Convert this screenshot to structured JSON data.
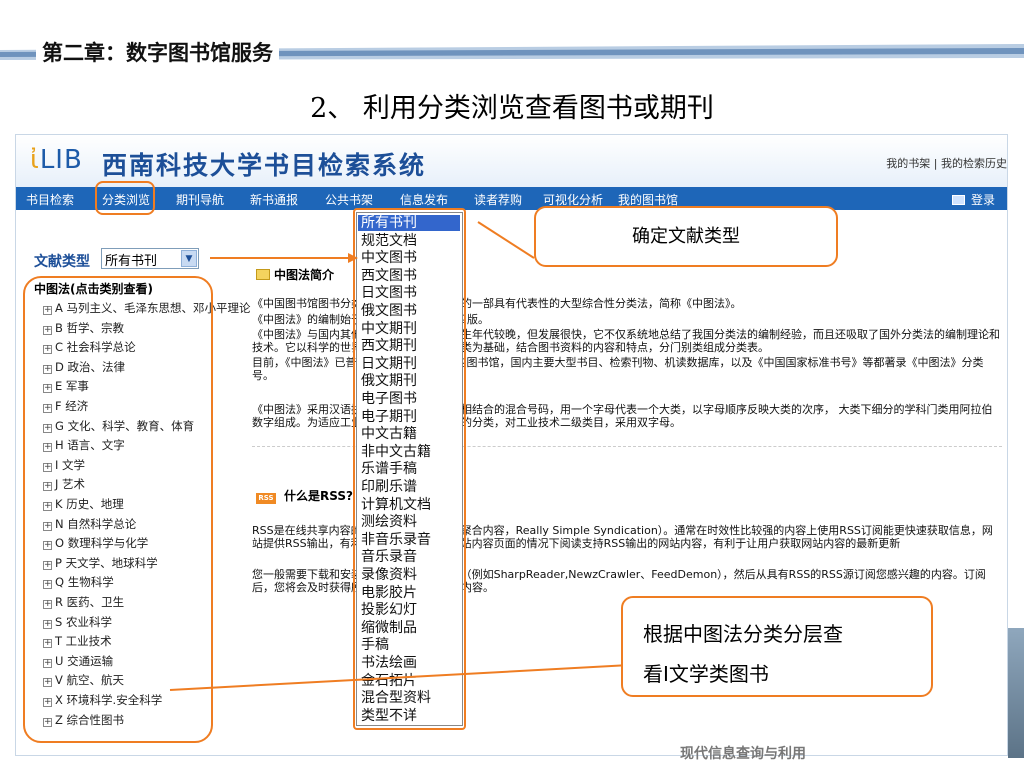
{
  "slide": {
    "chapter": "第二章：数字图书馆服务",
    "title": "2、 利用分类浏览查看图书或期刊",
    "watermark": "现代信息查询与利用"
  },
  "site": {
    "logo": "LIB",
    "title": "西南科技大学书目检索系统",
    "top_links": "我的书架 | 我的检索历史",
    "nav": [
      "书目检索",
      "分类浏览",
      "期刊导航",
      "新书通报",
      "公共书架",
      "信息发布",
      "读者荐购",
      "可视化分析",
      "我的图书馆"
    ],
    "login": "登录"
  },
  "filter": {
    "label": "文献类型",
    "selected": "所有书刊",
    "tree_heading": "中图法(点击类别查看)"
  },
  "categories": [
    "A 马列主义、毛泽东思想、邓小平理论",
    "B 哲学、宗教",
    "C 社会科学总论",
    "D 政治、法律",
    "E 军事",
    "F 经济",
    "G 文化、科学、教育、体育",
    "H 语言、文字",
    "I 文学",
    "J 艺术",
    "K 历史、地理",
    "N 自然科学总论",
    "O 数理科学与化学",
    "P 天文学、地球科学",
    "Q 生物科学",
    "R 医药、卫生",
    "S 农业科学",
    "T 工业技术",
    "U 交通运输",
    "V 航空、航天",
    "X 环境科学.安全科学",
    "Z 综合性图书"
  ],
  "doc_types": [
    "所有书刊",
    "规范文档",
    "中文图书",
    "西文图书",
    "日文图书",
    "俄文图书",
    "中文期刊",
    "西文期刊",
    "日文期刊",
    "俄文期刊",
    "电子图书",
    "电子期刊",
    "中文古籍",
    "非中文古籍",
    "乐谱手稿",
    "印刷乐谱",
    "计算机文档",
    "测绘资料",
    "非音乐录音",
    "音乐录音",
    "录像资料",
    "电影胶片",
    "投影幻灯",
    "缩微制品",
    "手稿",
    "书法绘画",
    "金石拓片",
    "混合型资料",
    "类型不详"
  ],
  "intro": {
    "heading": "中图法简介",
    "p1": "《中国图书馆图书分类法》是我国编制出版的一部具有代表性的大型综合性分类法，简称《中图法》。",
    "p2": "《中图法》的编制始于1971年，已出版了四版。",
    "p3": "《中图法》与国内其他分类法相比，编制产生年代较晚，但发展很快，它不仅系统地总结了我国分类法的编制经验，而且还吸取了国外分类法的编制理论和技术。它以科学的世界观为观点，以学科分类为基础，结合图书资料的内容和特点，分门别类组成分类表。",
    "p4": "目前，《中图法》已普遍应用在全国各类型的图书馆，国内主要大型书目、检索刊物、机读数据库，以及《中国国家标准书号》等都著录《中图法》分类号。",
    "p5": "《中图法》采用汉语拼音字母与阿拉伯数字相结合的混合号码，用一个字母代表一个大类，以字母顺序反映大类的次序， 大类下细分的学科门类用阿拉伯数字组成。为适应工业技术发展及该类文献的分类，对工业技术二级类目，采用双字母。"
  },
  "rss": {
    "icon": "RSS",
    "heading": "什么是RSS?",
    "p1": "RSS是在线共享内容的一种简易方式（也叫聚合内容，Really Simple Syndication）。通常在时效性比较强的内容上使用RSS订阅能更快速获取信息，网站提供RSS输出，有利于让用户在不打开网站内容页面的情况下阅读支持RSS输出的网站内容，有利于让用户获取网站内容的最新更新",
    "p2": "您一般需要下载和安装一个RSS新闻阅读器（例如SharpReader,NewzCrawler、FeedDemon），然后从具有RSS的RSS源订阅您感兴趣的内容。订阅后，您将会及时获得所订阅新闻频道的最新内容。"
  },
  "callouts": {
    "doc_type": "确定文献类型",
    "browse_line1": "根据中图法分类分层查",
    "browse_line2": "看I文学类图书"
  },
  "colors": {
    "accent": "#ef7d22",
    "nav_bg": "#1e66b8",
    "title_blue": "#1d4f98",
    "selected_bg": "#3366cc"
  }
}
